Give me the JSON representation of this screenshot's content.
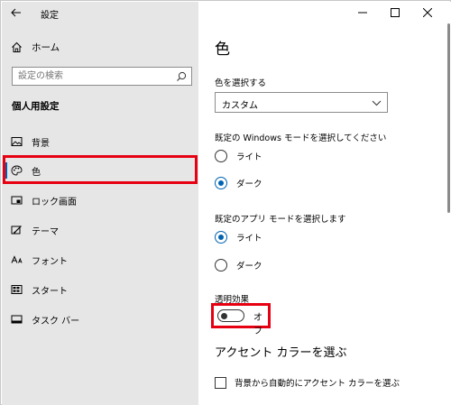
{
  "window": {
    "title": "設定"
  },
  "sidebar": {
    "home_label": "ホーム",
    "search_placeholder": "設定の検索",
    "section_heading": "個人用設定",
    "items": [
      {
        "label": "背景",
        "icon": "picture-icon"
      },
      {
        "label": "色",
        "icon": "palette-icon",
        "active": true
      },
      {
        "label": "ロック画面",
        "icon": "lock-screen-icon"
      },
      {
        "label": "テーマ",
        "icon": "theme-icon"
      },
      {
        "label": "フォント",
        "icon": "font-icon"
      },
      {
        "label": "スタート",
        "icon": "start-icon"
      },
      {
        "label": "タスク バー",
        "icon": "taskbar-icon"
      }
    ]
  },
  "content": {
    "page_title": "色",
    "choose_color_label": "色を選択する",
    "choose_color_value": "カスタム",
    "windows_mode_label": "既定の Windows モードを選択してください",
    "windows_mode_options": [
      {
        "label": "ライト",
        "checked": false
      },
      {
        "label": "ダーク",
        "checked": true
      }
    ],
    "app_mode_label": "既定のアプリ モードを選択します",
    "app_mode_options": [
      {
        "label": "ライト",
        "checked": true
      },
      {
        "label": "ダーク",
        "checked": false
      }
    ],
    "transparency_label": "透明効果",
    "transparency_state": "オフ",
    "accent_heading": "アクセント カラーを選ぶ",
    "auto_accent_label": "背景から自動的にアクセント カラーを選ぶ"
  },
  "colors": {
    "sidebar_bg": "#e6e6e6",
    "accent": "#0063b1",
    "highlight": "#e60012"
  }
}
